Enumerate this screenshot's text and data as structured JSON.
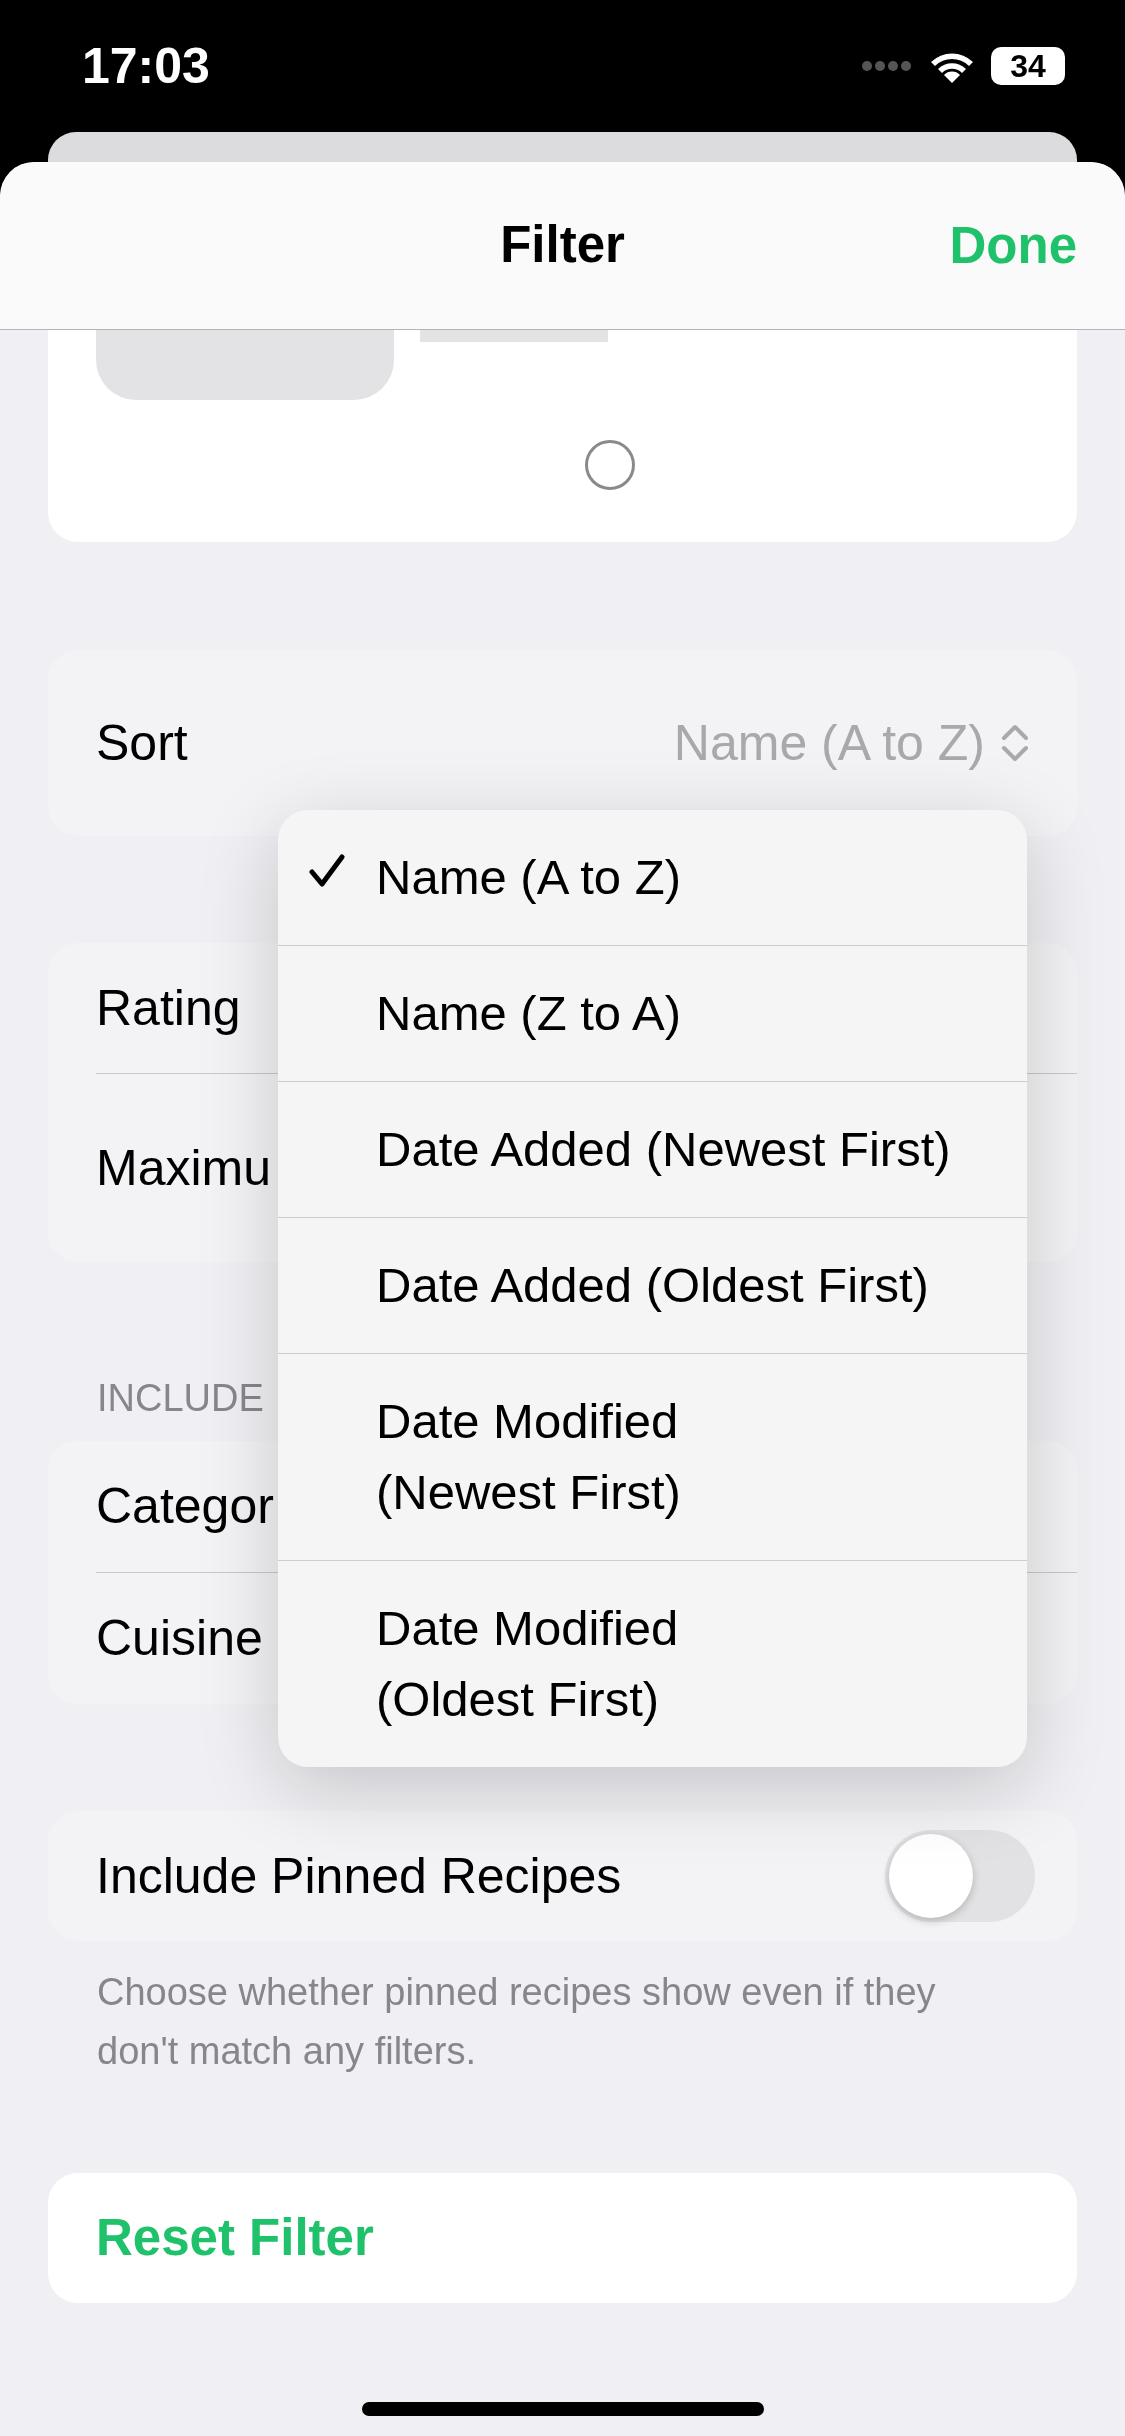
{
  "status_bar": {
    "time": "17:03",
    "battery": "34"
  },
  "nav": {
    "title": "Filter",
    "done": "Done"
  },
  "sort": {
    "label": "Sort",
    "value": "Name (A to Z)"
  },
  "limits": {
    "rows": [
      "Rating",
      "Maximu"
    ]
  },
  "include": {
    "header": "INCLUDE",
    "rows": [
      "Categor",
      "Cuisine"
    ]
  },
  "sort_menu": {
    "items": [
      {
        "label": "Name (A to Z)",
        "selected": true
      },
      {
        "label": "Name (Z to A)",
        "selected": false
      },
      {
        "label": "Date Added (Newest First)",
        "selected": false
      },
      {
        "label": "Date Added (Oldest First)",
        "selected": false
      },
      {
        "label": "Date Modified\n(Newest First)",
        "selected": false
      },
      {
        "label": "Date Modified\n(Oldest First)",
        "selected": false
      }
    ]
  },
  "pinned": {
    "label": "Include Pinned Recipes",
    "on": false,
    "footer": "Choose whether pinned recipes show even if they don't match any filters."
  },
  "reset": {
    "label": "Reset Filter"
  }
}
